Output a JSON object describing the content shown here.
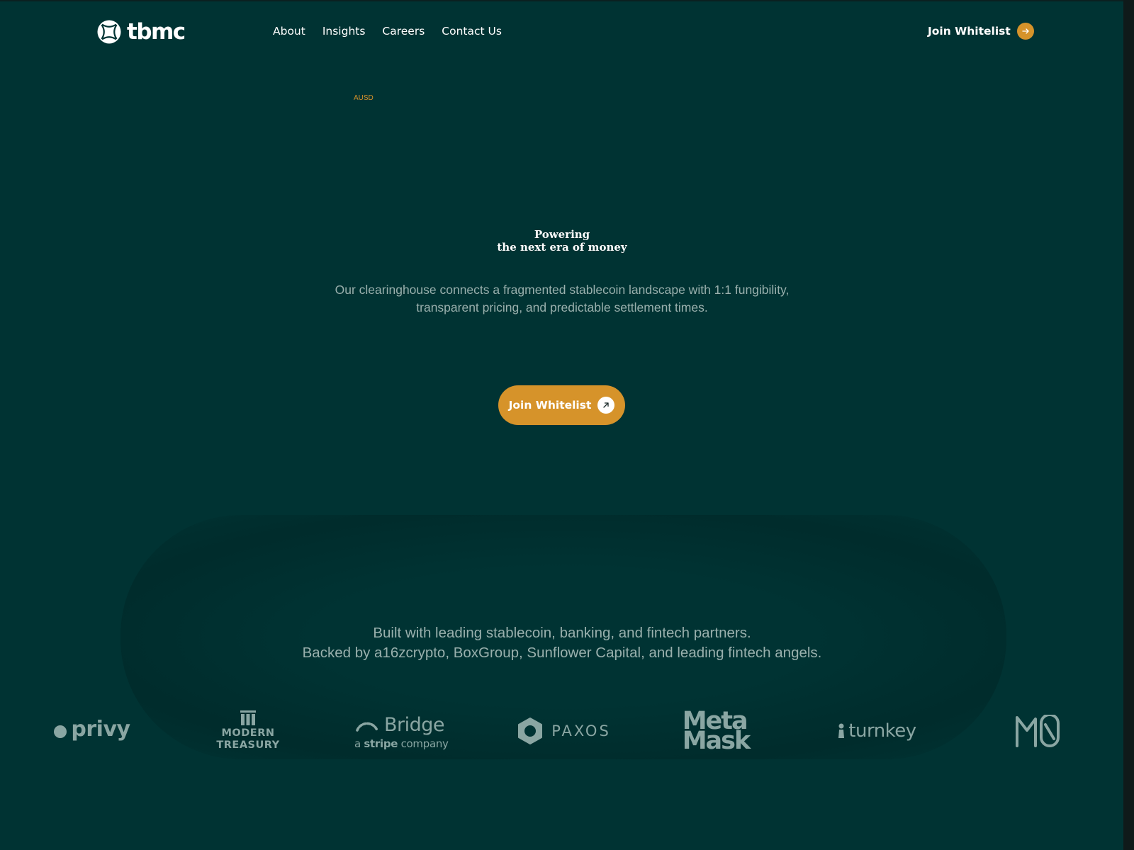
{
  "brand": {
    "name": "tbmc"
  },
  "nav": {
    "items": [
      "About",
      "Insights",
      "Careers",
      "Contact Us"
    ]
  },
  "header": {
    "cta_label": "Join Whitelist"
  },
  "hero": {
    "chip": "AUSD",
    "title_line1": "Powering",
    "title_line2": "the next era of money",
    "subtitle_line1": "Our clearinghouse connects a fragmented stablecoin landscape with 1:1 fungibility,",
    "subtitle_line2": "transparent pricing, and predictable settlement times.",
    "cta_label": "Join Whitelist"
  },
  "partners": {
    "line1": "Built with leading stablecoin, banking, and fintech partners.",
    "line2": "Backed by a16zcrypto, BoxGroup, Sunflower Capital, and leading fintech angels.",
    "logos": {
      "privy": "privy",
      "modern_treasury_line1": "MODERN",
      "modern_treasury_line2": "TREASURY",
      "bridge": "Bridge",
      "bridge_sub_a": "a",
      "bridge_sub_stripe": "stripe",
      "bridge_sub_company": "company",
      "paxos": "PAXOS",
      "metamask_line1": "Meta",
      "metamask_line2": "Mask",
      "turnkey": "turnkey"
    }
  },
  "colors": {
    "background": "#003333",
    "accent": "#d6932a",
    "muted_text": "#99b0ad",
    "logo_gray": "#8aa6a3"
  },
  "icons": {
    "logo": "circle-sphere-icon",
    "header_cta": "arrow-right-icon",
    "hero_cta": "arrow-up-right-icon"
  }
}
